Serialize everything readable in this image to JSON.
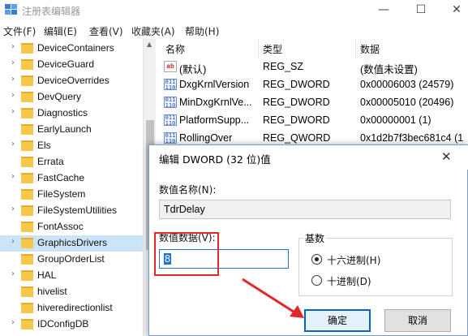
{
  "window": {
    "title": "注册表编辑器",
    "minimize_glyph": "—",
    "maximize_glyph": "☐",
    "close_glyph": "✕"
  },
  "menu": [
    "文件(F)",
    "编辑(E)",
    "查看(V)",
    "收藏夹(A)",
    "帮助(H)"
  ],
  "tree": {
    "items": [
      {
        "label": "DeviceContainers",
        "expandable": true
      },
      {
        "label": "DeviceGuard",
        "expandable": true
      },
      {
        "label": "DeviceOverrides",
        "expandable": true
      },
      {
        "label": "DevQuery",
        "expandable": true
      },
      {
        "label": "Diagnostics",
        "expandable": true
      },
      {
        "label": "EarlyLaunch",
        "expandable": false
      },
      {
        "label": "Els",
        "expandable": true
      },
      {
        "label": "Errata",
        "expandable": false
      },
      {
        "label": "FastCache",
        "expandable": true
      },
      {
        "label": "FileSystem",
        "expandable": false
      },
      {
        "label": "FileSystemUtilities",
        "expandable": true
      },
      {
        "label": "FontAssoc",
        "expandable": false
      },
      {
        "label": "GraphicsDrivers",
        "expandable": true,
        "selected": true
      },
      {
        "label": "GroupOrderList",
        "expandable": false
      },
      {
        "label": "HAL",
        "expandable": true
      },
      {
        "label": "hivelist",
        "expandable": false
      },
      {
        "label": "hiveredirectionlist",
        "expandable": false
      },
      {
        "label": "IDConfigDB",
        "expandable": true
      }
    ],
    "arrow_glyph": "›",
    "scroll_up_glyph": "▲"
  },
  "list": {
    "headers": [
      "名称",
      "类型",
      "数据"
    ],
    "rows": [
      {
        "icon": "string-value-icon",
        "icon_text": "ab",
        "name": "(默认)",
        "type": "REG_SZ",
        "data": "(数值未设置)"
      },
      {
        "icon": "binary-value-icon",
        "icon_text": "011\n110",
        "name": "DxgKrnlVersion",
        "type": "REG_DWORD",
        "data": "0x00006003 (24579)"
      },
      {
        "icon": "binary-value-icon",
        "icon_text": "011\n110",
        "name": "MinDxgKrnlVe...",
        "type": "REG_DWORD",
        "data": "0x00005010 (20496)"
      },
      {
        "icon": "binary-value-icon",
        "icon_text": "011\n110",
        "name": "PlatformSupp...",
        "type": "REG_DWORD",
        "data": "0x00000001 (1)"
      },
      {
        "icon": "binary-value-icon",
        "icon_text": "011\n110",
        "name": "RollingOver",
        "type": "REG_QWORD",
        "data": "0x1d2b7f3bec681c4 (1"
      }
    ]
  },
  "dialog": {
    "title": "编辑 DWORD (32 位)值",
    "close_glyph": "✕",
    "value_name_label": "数值名称(N):",
    "value_name": "TdrDelay",
    "value_data_label": "数值数据(V):",
    "value_data": "8",
    "base_label": "基数",
    "radio_hex": "十六进制(H)",
    "radio_dec": "十进制(D)",
    "base_selected": "hex",
    "ok_label": "确定",
    "cancel_label": "取消"
  },
  "colors": {
    "annotation_red": "#e02828",
    "selection_blue": "#cce4f7",
    "folder_yellow": "#f5c84c",
    "accent_blue": "#0a64c8"
  }
}
